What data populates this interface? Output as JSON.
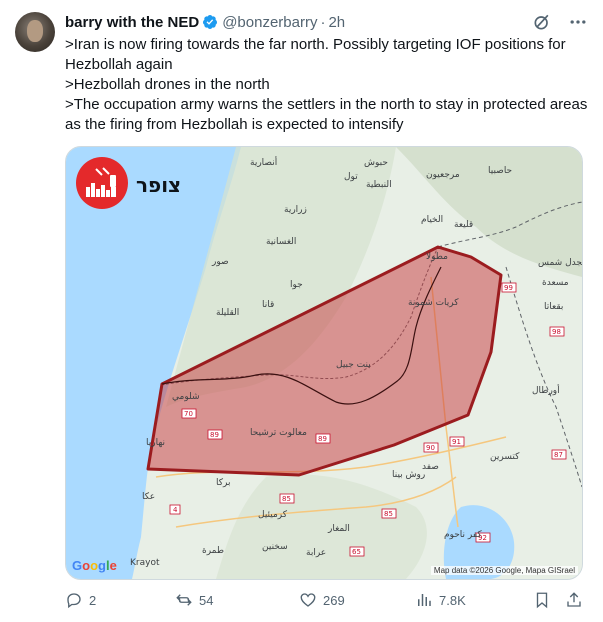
{
  "author": {
    "name": "barry with the NED",
    "handle": "@bonzerbarry",
    "time": "2h"
  },
  "body_lines": [
    ">Iran is now firing towards the far north. Possibly targeting IOF positions for Hezbollah again",
    ">Hezbollah drones in the north",
    ">The occupation army warns the settlers in the north to stay in protected areas as the firing from Hezbollah is expected to intensify"
  ],
  "media": {
    "badge_text": "צופר",
    "google_text": "Google",
    "attribution": "Map data ©2026 Google, Mapa GISrael",
    "map_labels": [
      "أنصارية",
      "حبوش",
      "النبطية",
      "مرجعيون",
      "الخيام",
      "زرارية",
      "الغسانية",
      "صور",
      "قانا",
      "القليلة",
      "كريات شمونة",
      "بنت جبيل",
      "شلومي",
      "نهاريا",
      "معالوت ترشيحا",
      "عكا",
      "كرميئيل",
      "كفر ناحوم",
      "مسعدة",
      "بقعاتا",
      "أورطال",
      "كتسرين",
      "روش بينا",
      "صفد",
      "طمرة",
      "سخنين",
      "عرابة",
      "المغار",
      "بركا",
      "Krayot",
      "حاصبيا",
      "مجدل شمس",
      "قليعة",
      "مطولا",
      "تول",
      "جوا"
    ],
    "road_numbers": [
      "99",
      "98",
      "70",
      "89",
      "89",
      "90",
      "91",
      "87",
      "85",
      "85",
      "65",
      "92",
      "4",
      "90"
    ]
  },
  "actions": {
    "replies": "2",
    "retweets": "54",
    "likes": "269",
    "views": "7.8K"
  },
  "colors": {
    "verified": "#1d9bf0",
    "zone_fill": "#c8373b",
    "zone_stroke": "#9b1c1f",
    "sea": "#aadaff",
    "land": "#e8efe6"
  }
}
